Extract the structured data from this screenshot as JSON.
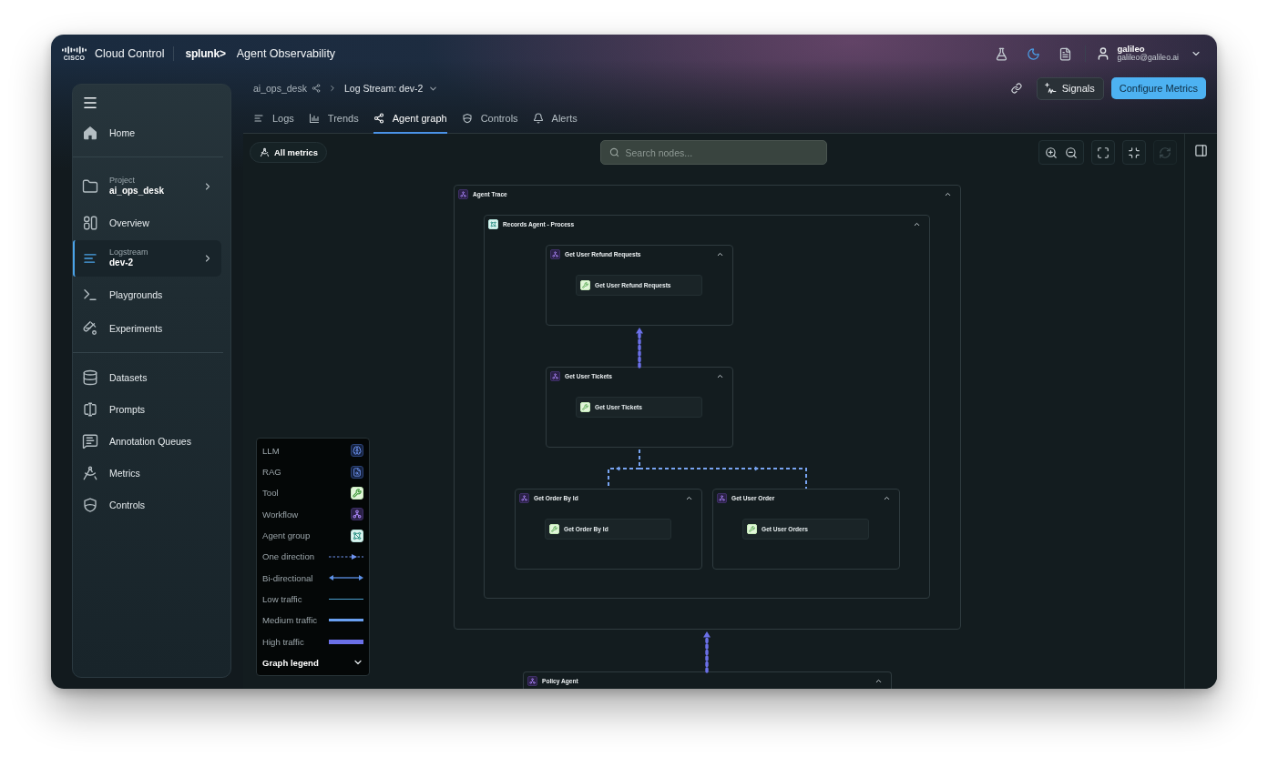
{
  "top_bar": {
    "logo_text": "CISCO",
    "product": "Cloud Control",
    "partner_logo": "splunk>",
    "app_name": "Agent Observability",
    "dark_mode": true,
    "user": {
      "name": "galileo",
      "email": "galileo@galileo.ai"
    }
  },
  "sidebar": {
    "sections": [
      {
        "items": [
          {
            "kind": "link",
            "label": "Home",
            "selected": false
          }
        ]
      },
      {
        "items": [
          {
            "kind": "context",
            "caption": "Project",
            "label": "ai_ops_desk",
            "selected": false
          },
          {
            "kind": "link",
            "label": "Overview",
            "selected": false
          },
          {
            "kind": "context",
            "caption": "Logstream",
            "label": "dev-2",
            "selected": true
          },
          {
            "kind": "link",
            "label": "Playgrounds",
            "selected": false
          },
          {
            "kind": "link",
            "label": "Experiments",
            "selected": false
          }
        ]
      },
      {
        "items": [
          {
            "kind": "link",
            "label": "Datasets",
            "selected": false
          },
          {
            "kind": "link",
            "label": "Prompts",
            "selected": false
          },
          {
            "kind": "link",
            "label": "Annotation Queues",
            "selected": false
          },
          {
            "kind": "link",
            "label": "Metrics",
            "selected": false
          },
          {
            "kind": "link",
            "label": "Controls",
            "selected": false
          }
        ]
      }
    ]
  },
  "breadcrumbs": [
    {
      "kind": "link",
      "label": "ai_ops_desk"
    },
    {
      "kind": "dropdown",
      "label": "Log Stream: dev-2"
    }
  ],
  "header_actions": [
    {
      "kind": "secondary",
      "label": "Signals"
    },
    {
      "kind": "primary",
      "label": "Configure Metrics"
    }
  ],
  "tabs": [
    {
      "label": "Logs",
      "selected": false
    },
    {
      "label": "Trends",
      "selected": false
    },
    {
      "label": "Agent graph",
      "selected": true
    },
    {
      "label": "Controls",
      "selected": false
    },
    {
      "label": "Alerts",
      "selected": false
    }
  ],
  "canvas_toolbar": {
    "metrics_button": {
      "label": "All metrics"
    },
    "search": {
      "placeholder": "Search nodes..."
    },
    "reset_view": {
      "disabled": true
    }
  },
  "graph": {
    "nodes": [
      {
        "kind": "workflow",
        "label": "Agent Trace",
        "expanded": true,
        "children": [
          {
            "kind": "agent_group",
            "label": "Records Agent - Process",
            "expanded": true,
            "children": [
              {
                "kind": "workflow",
                "label": "Get User Refund Requests",
                "expanded": true,
                "children": [
                  {
                    "kind": "tool",
                    "label": "Get User Refund Requests"
                  }
                ]
              },
              {
                "kind": "workflow",
                "label": "Get User Tickets",
                "expanded": true,
                "children": [
                  {
                    "kind": "tool",
                    "label": "Get User Tickets"
                  }
                ]
              },
              {
                "kind": "workflow",
                "label": "Get Order By Id",
                "expanded": true,
                "children": [
                  {
                    "kind": "tool",
                    "label": "Get Order By Id"
                  }
                ]
              },
              {
                "kind": "workflow",
                "label": "Get User Order",
                "expanded": true,
                "children": [
                  {
                    "kind": "tool",
                    "label": "Get User Orders"
                  }
                ]
              }
            ]
          }
        ]
      },
      {
        "kind": "workflow",
        "label": "Policy Agent",
        "expanded": true
      }
    ],
    "edges": [
      {
        "kind": "one_direction",
        "high_traffic": true
      },
      {
        "kind": "one_direction",
        "high_traffic": false
      },
      {
        "kind": "one_direction",
        "high_traffic": false
      },
      {
        "kind": "one_direction",
        "high_traffic": true
      }
    ]
  },
  "legend": {
    "expanded": true,
    "items": [
      {
        "label": "LLM",
        "kind": "llm"
      },
      {
        "label": "RAG",
        "kind": "rag"
      },
      {
        "label": "Tool",
        "kind": "tool"
      },
      {
        "label": "Workflow",
        "kind": "workflow"
      },
      {
        "label": "Agent group",
        "kind": "agent_group"
      },
      {
        "label": "One direction",
        "kind": "one_direction"
      },
      {
        "label": "Bi-directional",
        "kind": "bi_directional"
      },
      {
        "label": "Low traffic",
        "kind": "low_traffic"
      },
      {
        "label": "Medium traffic",
        "kind": "medium_traffic"
      },
      {
        "label": "High traffic",
        "kind": "high_traffic"
      }
    ],
    "title": "Graph legend"
  }
}
